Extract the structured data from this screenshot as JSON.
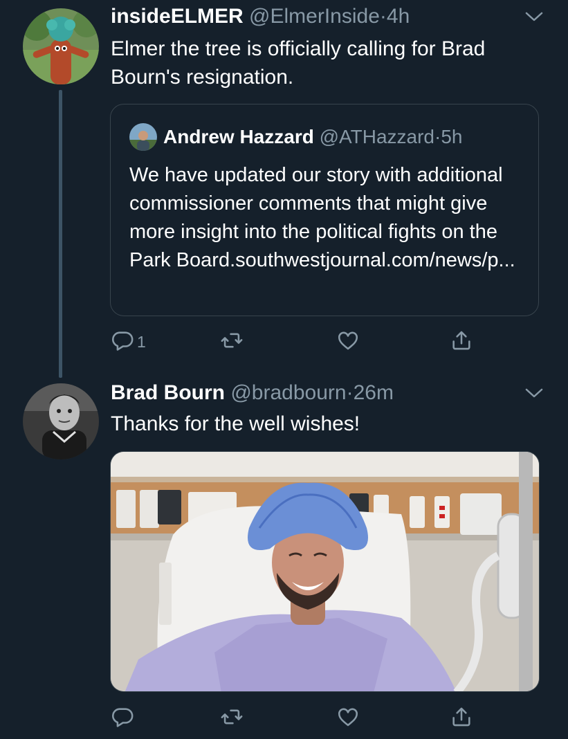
{
  "tweets": [
    {
      "display_name": "insideELMER",
      "handle": "@ElmerInside",
      "separator": "·",
      "time": "4h",
      "text": "Elmer the tree is officially calling for Brad Bourn's resignation.",
      "quoted": {
        "display_name": "Andrew Hazzard",
        "handle": "@ATHazzard",
        "separator": "·",
        "time": "5h",
        "text": "We have updated our story with additional commissioner comments that might give more insight into the political fights on the Park Board.southwestjournal.com/news/p..."
      },
      "actions": {
        "reply_count": "1"
      }
    },
    {
      "display_name": "Brad Bourn",
      "handle": "@bradbourn",
      "separator": "·",
      "time": "26m",
      "text": "Thanks for the well wishes!"
    }
  ],
  "icons": [
    "chevron-down-icon",
    "reply-icon",
    "retweet-icon",
    "like-icon",
    "share-icon"
  ],
  "colors": {
    "background": "#15202b",
    "secondary_text": "#8899a6",
    "border": "#38444d",
    "thread_line": "#3d5466"
  }
}
